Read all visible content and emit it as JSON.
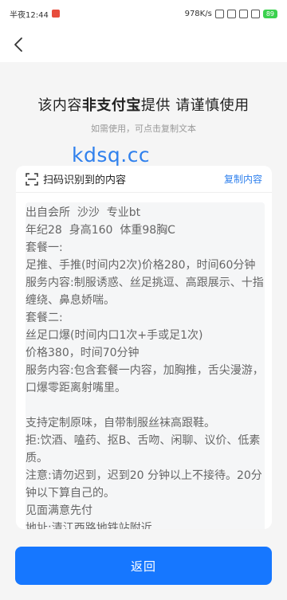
{
  "status_bar": {
    "time": "半夜12:44",
    "network_speed": "978K/s",
    "battery": "89"
  },
  "nav": {
    "back_icon": "chevron-left-icon"
  },
  "notice": {
    "title_part1": "该内容",
    "title_bold": "非支付宝",
    "title_part2": "提供  请谨慎使用",
    "subtitle": "如需使用，可点击复制文本"
  },
  "watermark": "kdsq.cc",
  "card": {
    "header_title": "扫码识别到的内容",
    "copy_label": "复制内容",
    "lines": [
      "出自会所  沙沙  专业bt",
      "年纪28  身高160  体重98胸C",
      "套餐一:",
      "足推、手推(时间内2次)价格280，时间60分钟",
      "服务内容:制服诱惑、丝足挑逗、高跟展示、十指缠绕、鼻息娇喘。",
      "套餐二:",
      "丝足口爆(时间内口1次+手或足1次)",
      "价格380，时间70分钟",
      "服务内容:包含套餐一内容，加胸推，舌尖漫游，口爆零距离射嘴里。",
      "",
      "支持定制原味，自带制服丝袜高跟鞋。",
      "拒:饮酒、嗑药、抠B、舌吻、闲聊、议价、低素质。",
      "注意:请勿迟到，迟到20 分钟以上不接待。20分钟以下算自己的。",
      "见面满意先付",
      "地址:清江西路地铁站附近"
    ]
  },
  "footer": {
    "return_label": "返回"
  },
  "colors": {
    "accent": "#1677ff",
    "link": "#2f80ed",
    "page_bg": "#f5f5f5"
  }
}
